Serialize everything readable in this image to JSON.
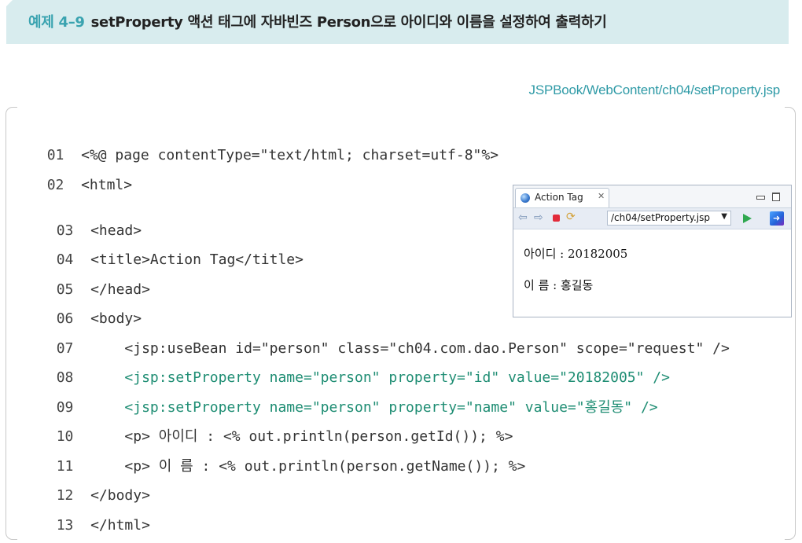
{
  "header": {
    "example_label": "예제 4–9",
    "title": "setProperty 액션 태그에 자바빈즈 Person으로 아이디와 이름을 설정하여 출력하기"
  },
  "file_path": "JSPBook/WebContent/ch04/setProperty.jsp",
  "code": {
    "lines": [
      {
        "num": "01",
        "text": "<%@ page contentType=\"text/html; charset=utf-8\"%>"
      },
      {
        "num": "02",
        "text": "<html>"
      },
      {
        "num": "03",
        "text": "<head>"
      },
      {
        "num": "04",
        "text": "<title>Action Tag</title>"
      },
      {
        "num": "05",
        "text": "</head>"
      },
      {
        "num": "06",
        "text": "<body>"
      },
      {
        "num": "07",
        "text": "    <jsp:useBean id=\"person\" class=\"ch04.com.dao.Person\" scope=\"request\" />"
      },
      {
        "num": "08",
        "text": "    <jsp:setProperty name=\"person\" property=\"id\" value=\"20182005\" />"
      },
      {
        "num": "09",
        "text": "    <jsp:setProperty name=\"person\" property=\"name\" value=\"홍길동\" />"
      },
      {
        "num": "10",
        "text": "    <p> 아이디 : <% out.println(person.getId()); %>"
      },
      {
        "num": "11",
        "text": "    <p> 이 름 : <% out.println(person.getName()); %>"
      },
      {
        "num": "12",
        "text": "</body>"
      },
      {
        "num": "13",
        "text": "</html>"
      }
    ]
  },
  "browser": {
    "tab_title": "Action Tag",
    "tab_close": "✕",
    "url": "/ch04/setProperty.jsp",
    "output": {
      "id_line": "아이디 : 20182005",
      "name_line": "이 름 : 홍길동"
    }
  },
  "colors": {
    "accent": "#3aa3b0",
    "banner_bg": "#d8ecee",
    "path_color": "#2e9aa6",
    "highlight_code": "#1e8d73"
  }
}
